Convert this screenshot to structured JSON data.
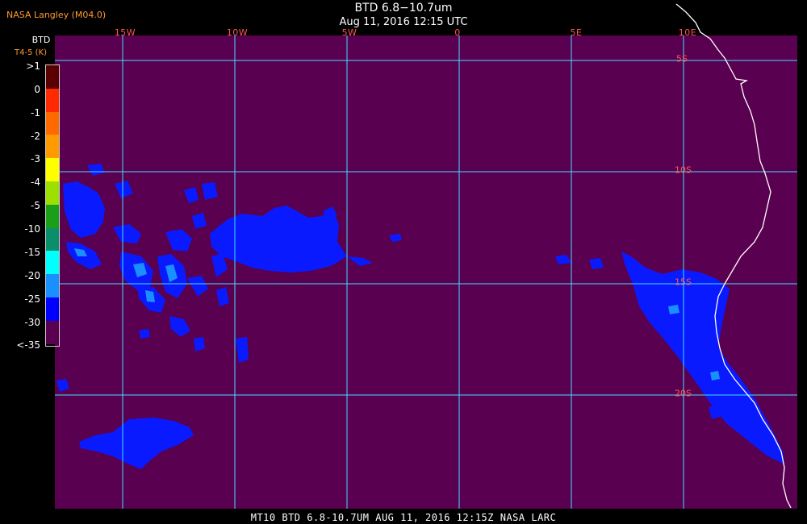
{
  "producer": "NASA Langley (M04.0)",
  "title": "BTD 6.8−10.7um",
  "subtitle": "Aug 11, 2016 12:15 UTC",
  "footer": "MT10  BTD 6.8-10.7UM  AUG 11, 2016 12:15Z  NASA LARC",
  "legend": {
    "title_line1": "BTD",
    "title_line2": "T4-5 (K)",
    "labels": [
      ">1",
      "0",
      "-1",
      "-2",
      "-3",
      "-4",
      "-5",
      "-10",
      "-15",
      "-20",
      "-25",
      "-30",
      "<-35"
    ],
    "colors": [
      "#5a0000",
      "#cc0000",
      "#ff2a00",
      "#ff6a00",
      "#ff9a00",
      "#ffff00",
      "#9be000",
      "#1a9f1a",
      "#0a8f6a",
      "#00ffff",
      "#1a8fff",
      "#0000ff",
      "#5a0050"
    ]
  },
  "map": {
    "background_color": "#5a0050",
    "cloud_color": "#0a1aff",
    "grid_color": "#40e0ff",
    "coast_color": "#ffffff",
    "lon_labels": [
      "15W",
      "10W",
      "5W",
      "0",
      "5E",
      "10E"
    ],
    "lat_labels": [
      "5S",
      "10S",
      "15S",
      "20S"
    ]
  }
}
